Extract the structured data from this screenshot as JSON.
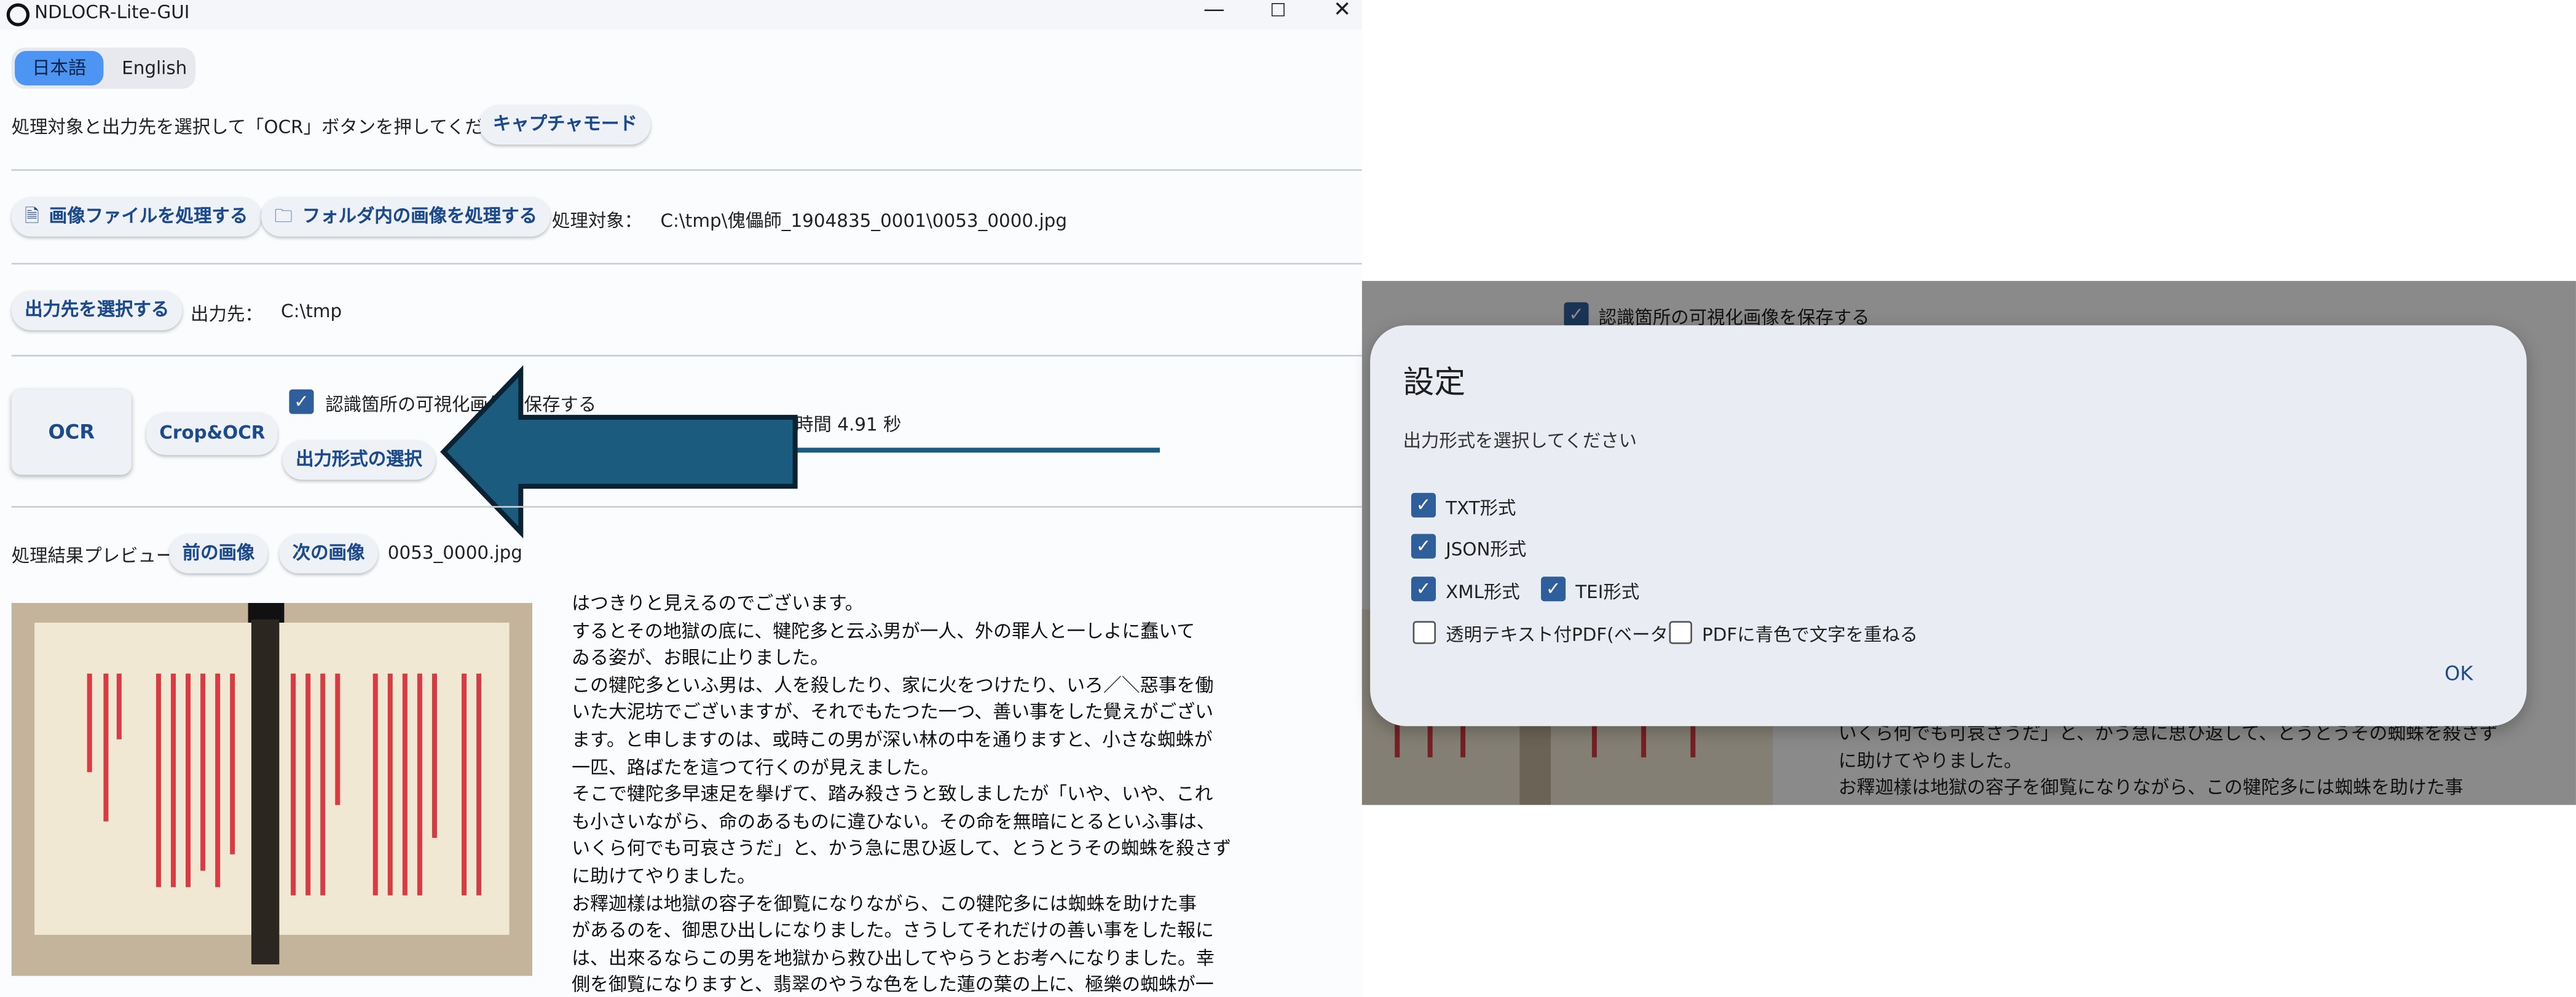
{
  "window": {
    "title": "NDLOCR-Lite-GUI",
    "controls": {
      "minimize": "—",
      "maximize": "☐",
      "close": "✕"
    }
  },
  "lang": {
    "ja": "日本語",
    "en": "English"
  },
  "instruction": "処理対象と出力先を選択して「OCR」ボタンを押してください",
  "capture_mode": "キャプチャモード",
  "process_image": "画像ファイルを処理する",
  "process_folder": "フォルダ内の画像を処理する",
  "target_label": "処理対象：",
  "target_value": "C:\\tmp\\傀儡師_1904835_0001\\0053_0000.jpg",
  "select_output": "出力先を選択する",
  "output_label": "出力先：",
  "output_value": "C:\\tmp",
  "ocr": "OCR",
  "crop_ocr": "Crop&OCR",
  "save_vis": "認識箇所の可視化画像を保存する",
  "status": "1 画像OCR完了 / 所要時間 4.91 秒",
  "select_format": "出力形式の選択",
  "preview_label": "処理結果プレビュー",
  "prev_image": "前の画像",
  "next_image": "次の画像",
  "current_file": "0053_0000.jpg",
  "preview_lines": [
    "はつきりと見えるのでございます。",
    "するとその地獄の底に、犍陀多と云ふ男が一人、外の罪人と一しよに蠢いて",
    "ゐる姿が、お眼に止りました。",
    "この犍陀多といふ男は、人を殺したり、家に火をつけたり、いろ／＼惡事を働",
    "いた大泥坊でございますが、それでもたつた一つ、善い事をした覺えがござい",
    "ます。と申しますのは、或時この男が深い林の中を通りますと、小さな蜘蛛が",
    "一匹、路ばたを這つて行くのが見えました。",
    "そこで犍陀多早速足を擧げて、踏み殺さうと致しましたが「いや、いや、これ",
    "も小さいながら、命のあるものに違ひない。その命を無暗にとるといふ事は、",
    "いくら何でも可哀さうだ」と、かう急に思ひ返して、とうとうその蜘蛛を殺さず",
    "に助けてやりました。",
    "お釋迦樣は地獄の容子を御覧になりながら、この犍陀多には蜘蛛を助けた事",
    "があるのを、御思ひ出しになりました。さうしてそれだけの善い事をした報に",
    "は、出來るならこの男を地獄から救ひ出してやらうとお考へになりました。幸",
    "側を御覧になりますと、翡翠のやうな色をした蓮の葉の上に、極樂の蜘蛛が一"
  ],
  "bg_partial": {
    "save_vis": "認識箇所の可視化画像を保存する",
    "lines": [
      "いくら何でも可哀さうだ」と、かう急に思ひ返して、とうとうその蜘蛛を殺さず",
      "に助けてやりました。",
      "お釋迦樣は地獄の容子を御覧になりながら、この犍陀多には蜘蛛を助けた事"
    ]
  },
  "dialog": {
    "title": "設定",
    "subtitle": "出力形式を選択してください",
    "options": {
      "txt": "TXT形式",
      "json": "JSON形式",
      "xml": "XML形式",
      "tei": "TEI形式",
      "pdf": "透明テキスト付PDF(ベータ)",
      "pdf_blue": "PDFに青色で文字を重ねる"
    },
    "checked": {
      "txt": true,
      "json": true,
      "xml": true,
      "tei": true,
      "pdf": false,
      "pdf_blue": false
    },
    "ok": "OK"
  },
  "colors": {
    "accent": "#4d95f3",
    "button_text": "#1c4a8a",
    "arrow": "#1b5b7d",
    "checkbox": "#2f5f9a"
  },
  "icons": {
    "file": "file-plus-icon",
    "folder": "folder-icon",
    "arrow": "left-arrow-annotation"
  }
}
